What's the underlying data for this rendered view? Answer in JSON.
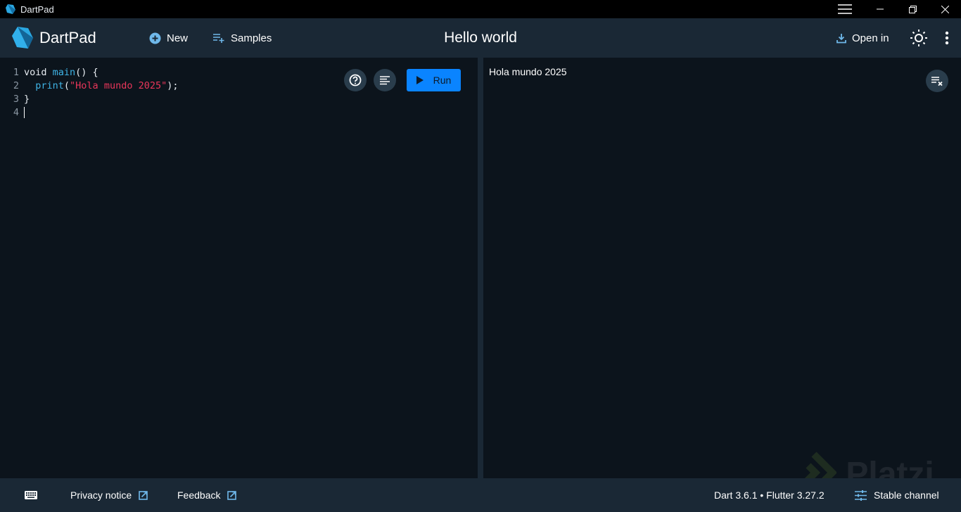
{
  "window": {
    "title": "DartPad"
  },
  "header": {
    "brand": "DartPad",
    "new_label": "New",
    "samples_label": "Samples",
    "title": "Hello world",
    "open_in_label": "Open in"
  },
  "editor": {
    "lines": [
      {
        "num": "1",
        "tokens": [
          {
            "t": "void ",
            "c": "kw"
          },
          {
            "t": "main",
            "c": "fn"
          },
          {
            "t": "() {",
            "c": "kw"
          }
        ]
      },
      {
        "num": "2",
        "tokens": [
          {
            "t": "  ",
            "c": "kw"
          },
          {
            "t": "print",
            "c": "fn"
          },
          {
            "t": "(",
            "c": "kw"
          },
          {
            "t": "\"Hola mundo 2025\"",
            "c": "str"
          },
          {
            "t": ");",
            "c": "kw"
          }
        ]
      },
      {
        "num": "3",
        "tokens": [
          {
            "t": "}",
            "c": "kw"
          }
        ]
      },
      {
        "num": "4",
        "tokens": []
      }
    ],
    "run_label": "Run"
  },
  "output": {
    "text": "Hola mundo 2025"
  },
  "footer": {
    "privacy": "Privacy notice",
    "feedback": "Feedback",
    "versions": "Dart 3.6.1 • Flutter 3.27.2",
    "channel": "Stable channel"
  },
  "watermark": "Platzi",
  "colors": {
    "accent": "#0a84ff",
    "header_bg": "#1a2835",
    "editor_bg": "#0c141c",
    "icon_blue": "#6fb8ea"
  }
}
